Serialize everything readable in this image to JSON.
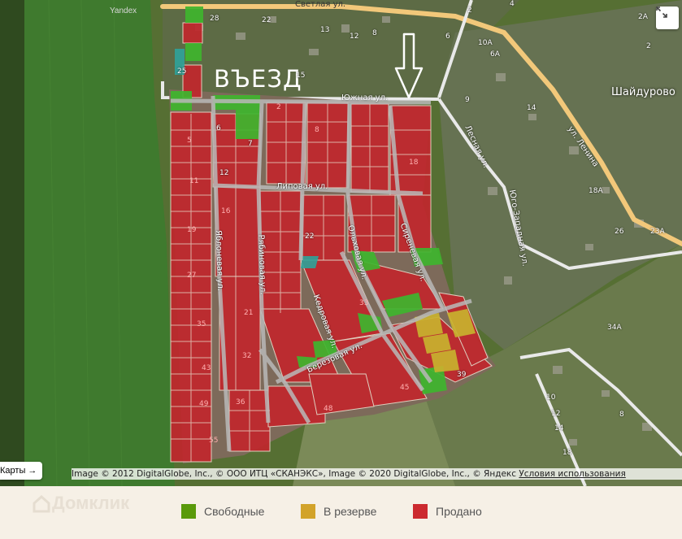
{
  "map": {
    "watermark": "Yandex",
    "entry_label": "ВЪЕЗД",
    "locality": "Шайдурово",
    "streets": {
      "svetlaya": "Светлая ул.",
      "yuzhnaya": "Южная ул.",
      "lipovaya": "Липовая ул.",
      "lenina": "ул. Ленина",
      "lesnaya": "Лесная ул.",
      "yugo_zapadnaya": "Юго-Западная ул.",
      "yablonevaya": "Яблоневая ул.",
      "ryabinovaya": "Рябиновая ул.",
      "olkhovaya": "Ольховая ул.",
      "sirenevaya": "Сиреневая ул.",
      "kedrovaya": "Кедровая ул.",
      "berezovaya": "Березовая ул."
    },
    "plot_numbers": [
      "25",
      "2",
      "6",
      "7",
      "5",
      "12",
      "11",
      "16",
      "19",
      "27",
      "35",
      "43",
      "49",
      "55",
      "36",
      "32",
      "21",
      "33",
      "45",
      "39",
      "22",
      "48",
      "18",
      "8"
    ],
    "house_numbers": [
      "28",
      "22",
      "15",
      "13",
      "12",
      "8",
      "2",
      "4",
      "6",
      "2А",
      "2",
      "10А",
      "6А",
      "9",
      "14",
      "18А",
      "26",
      "23А",
      "34А",
      "10",
      "12",
      "14",
      "18",
      "8"
    ],
    "copyright": "Image © 2012 DigitalGlobe, Inc., © ООО ИТЦ «СКАНЭКС», Image © 2020 DigitalGlobe, Inc., © Яндекс ",
    "terms_link": "Условия использования",
    "maps_button": "Карты →",
    "fullscreen_icon": "expand-icon"
  },
  "legend": {
    "brand": "Домклик",
    "items": [
      {
        "label": "Свободные",
        "color": "#5a9a0b"
      },
      {
        "label": "В резерве",
        "color": "#d2a32a"
      },
      {
        "label": "Продано",
        "color": "#cc2a2f"
      }
    ]
  }
}
